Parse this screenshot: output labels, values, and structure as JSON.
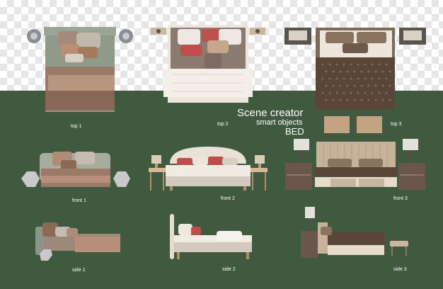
{
  "scene": {
    "headline": "Scene creator",
    "subhead": "smart objects",
    "product": "BED"
  },
  "views": {
    "top_1": "top 1",
    "top_2": "top 2",
    "top_3": "top 3",
    "front_1": "front 1",
    "front_2": "front 2",
    "front_3": "front 3",
    "side_1": "side 1",
    "side_2": "side 2",
    "side_3": "side 3"
  },
  "colors": {
    "background_top": "checkerboard",
    "background_bottom": "#3f5a3e",
    "bed1": "#8a7e6e",
    "bed2": "#f0ece4",
    "bed3": "#5a4636"
  }
}
